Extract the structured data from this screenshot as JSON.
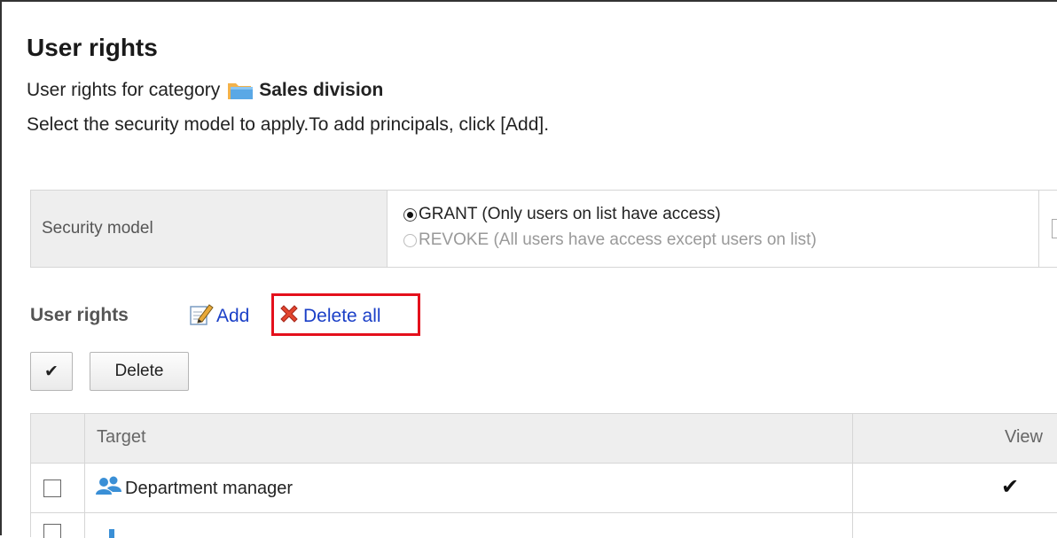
{
  "page": {
    "title": "User rights",
    "description_prefix": "User rights for category",
    "category_name": "Sales division",
    "instruction": "Select the security model to apply.To add principals, click [Add]."
  },
  "security_model": {
    "label": "Security model",
    "options": [
      {
        "label": "GRANT (Only users on list have access)",
        "selected": true,
        "enabled": true
      },
      {
        "label": "REVOKE (All users have access except users on list)",
        "selected": false,
        "enabled": false
      }
    ]
  },
  "user_rights": {
    "label": "User rights",
    "add_label": "Add",
    "delete_all_label": "Delete all",
    "check_all_symbol": "✔",
    "delete_button": "Delete"
  },
  "table": {
    "headers": {
      "target": "Target",
      "view": "View"
    },
    "rows": [
      {
        "name": "Department manager",
        "view": "✔",
        "icon": "group-icon"
      }
    ]
  },
  "colors": {
    "link": "#1a3fc7",
    "highlight": "#e4101c",
    "header_bg": "#eeeeee"
  }
}
